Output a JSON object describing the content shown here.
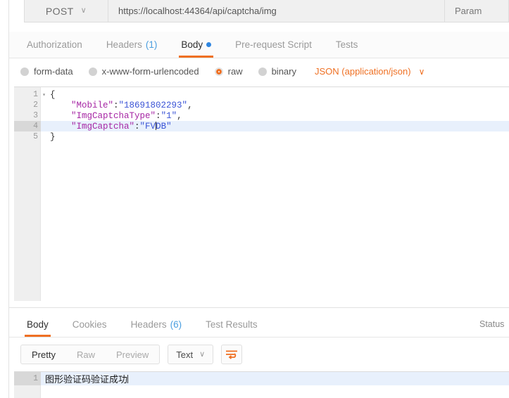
{
  "request_bar": {
    "method": "POST",
    "method_caret": "∨",
    "url": "https://localhost:44364/api/captcha/img",
    "params_label": "Param"
  },
  "request_tabs": [
    {
      "label": "Authorization",
      "count": null,
      "dot": false,
      "active": false
    },
    {
      "label": "Headers",
      "count": "(1)",
      "dot": false,
      "active": false
    },
    {
      "label": "Body",
      "count": null,
      "dot": true,
      "active": true
    },
    {
      "label": "Pre-request Script",
      "count": null,
      "dot": false,
      "active": false
    },
    {
      "label": "Tests",
      "count": null,
      "dot": false,
      "active": false
    }
  ],
  "body_type": {
    "options": [
      {
        "label": "form-data",
        "selected": false
      },
      {
        "label": "x-www-form-urlencoded",
        "selected": false
      },
      {
        "label": "raw",
        "selected": true
      },
      {
        "label": "binary",
        "selected": false
      }
    ],
    "content_type": "JSON (application/json)",
    "content_type_caret": "∨"
  },
  "editor": {
    "active_line": 4,
    "lines": [
      {
        "num": "1",
        "fold": "▾",
        "tokens": [
          {
            "t": "{",
            "c": "punc"
          }
        ]
      },
      {
        "num": "2",
        "fold": "",
        "tokens": [
          {
            "t": "    ",
            "c": "punc"
          },
          {
            "t": "\"Mobile\"",
            "c": "key"
          },
          {
            "t": ":",
            "c": "punc"
          },
          {
            "t": "\"18691802293\"",
            "c": "str"
          },
          {
            "t": ",",
            "c": "punc"
          }
        ]
      },
      {
        "num": "3",
        "fold": "",
        "tokens": [
          {
            "t": "    ",
            "c": "punc"
          },
          {
            "t": "\"ImgCaptchaType\"",
            "c": "key"
          },
          {
            "t": ":",
            "c": "punc"
          },
          {
            "t": "\"1\"",
            "c": "str"
          },
          {
            "t": ",",
            "c": "punc"
          }
        ]
      },
      {
        "num": "4",
        "fold": "",
        "tokens": [
          {
            "t": "    ",
            "c": "punc"
          },
          {
            "t": "\"ImgCaptcha\"",
            "c": "key"
          },
          {
            "t": ":",
            "c": "punc"
          },
          {
            "t": "\"FV",
            "c": "str"
          },
          {
            "t": "|",
            "c": "caret"
          },
          {
            "t": "DB\"",
            "c": "str"
          }
        ]
      },
      {
        "num": "5",
        "fold": "",
        "tokens": [
          {
            "t": "}",
            "c": "punc"
          }
        ]
      }
    ]
  },
  "response_tabs": [
    {
      "label": "Body",
      "count": null,
      "active": true
    },
    {
      "label": "Cookies",
      "count": null,
      "active": false
    },
    {
      "label": "Headers",
      "count": "(6)",
      "active": false
    },
    {
      "label": "Test Results",
      "count": null,
      "active": false
    }
  ],
  "response_status_label": "Status",
  "response_toolbar": {
    "views": [
      {
        "label": "Pretty",
        "active": true
      },
      {
        "label": "Raw",
        "active": false
      },
      {
        "label": "Preview",
        "active": false
      }
    ],
    "format": "Text",
    "format_caret": "∨",
    "wrap_icon": "word-wrap-icon"
  },
  "response_body": {
    "lines": [
      {
        "num": "1",
        "text": "图形验证码验证成功",
        "active": true,
        "caret": true
      }
    ]
  },
  "colors": {
    "accent_orange": "#ef7023",
    "link_blue": "#4a9ee0",
    "dot_blue": "#2f86e0",
    "active_line": "#e8f0fc",
    "gutter": "#efefef"
  }
}
